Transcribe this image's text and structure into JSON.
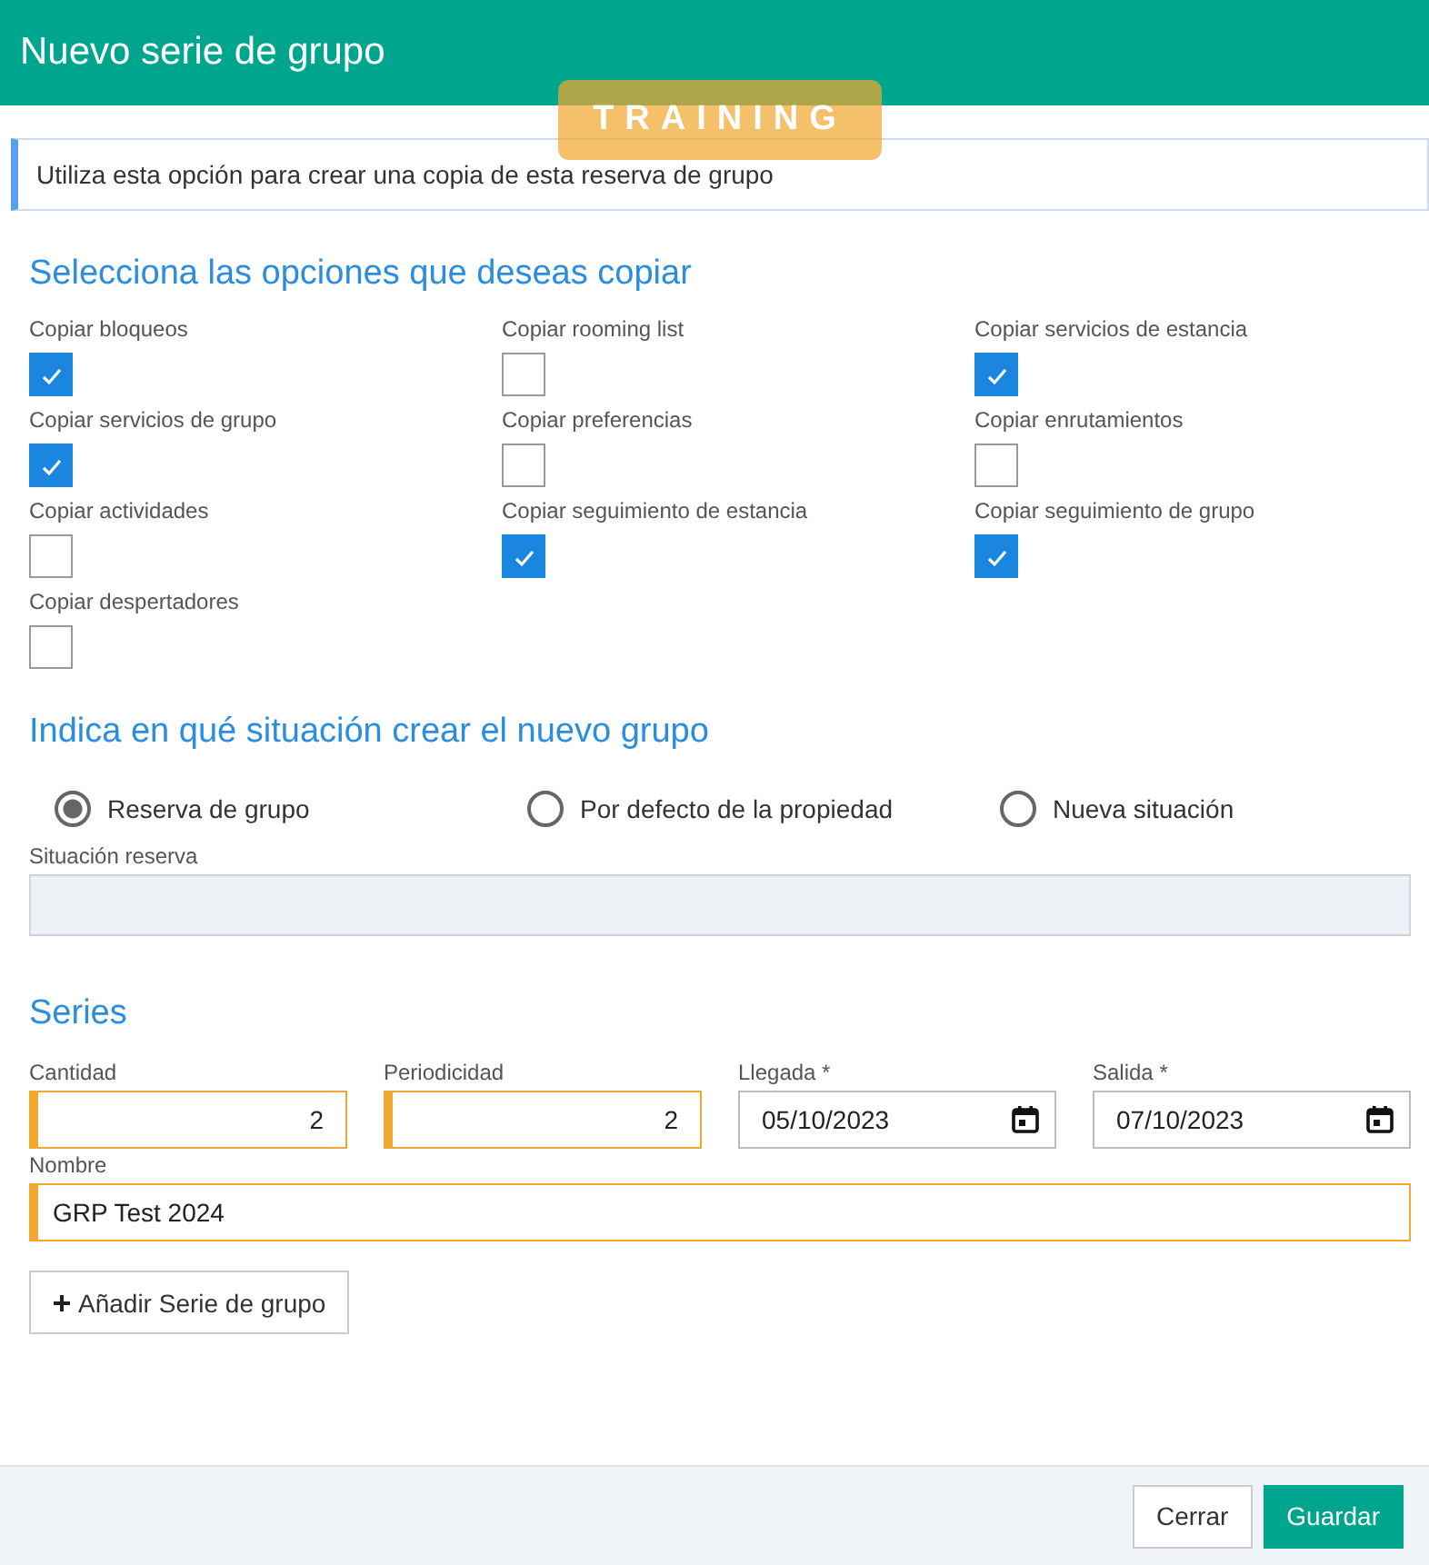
{
  "dialog": {
    "title": "Nuevo serie de grupo"
  },
  "environment_badge": "TRAINING",
  "info": "Utiliza esta opción para crear una copia de esta reserva de grupo",
  "copy_section": {
    "title": "Selecciona las opciones que deseas copiar",
    "options": [
      {
        "label": "Copiar bloqueos",
        "checked": true
      },
      {
        "label": "Copiar rooming list",
        "checked": false
      },
      {
        "label": "Copiar servicios de estancia",
        "checked": true
      },
      {
        "label": "Copiar servicios de grupo",
        "checked": true
      },
      {
        "label": "Copiar preferencias",
        "checked": false
      },
      {
        "label": "Copiar enrutamientos",
        "checked": false
      },
      {
        "label": "Copiar actividades",
        "checked": false
      },
      {
        "label": "Copiar seguimiento de estancia",
        "checked": true
      },
      {
        "label": "Copiar seguimiento de grupo",
        "checked": true
      },
      {
        "label": "Copiar despertadores",
        "checked": false
      }
    ]
  },
  "situation_section": {
    "title": "Indica en qué situación crear el nuevo grupo",
    "choices": [
      {
        "label": "Reserva de grupo",
        "selected": true
      },
      {
        "label": "Por defecto de la propiedad",
        "selected": false
      },
      {
        "label": "Nueva situación",
        "selected": false
      }
    ],
    "field": {
      "label": "Situación reserva",
      "disabled": true
    }
  },
  "series_section": {
    "title": "Series",
    "fields": [
      {
        "label": "Cantidad",
        "value": "2",
        "kind": "number",
        "required": true
      },
      {
        "label": "Periodicidad",
        "value": "2",
        "kind": "number",
        "required": true
      },
      {
        "label": "Llegada *",
        "value": "05/10/2023",
        "kind": "date",
        "required": false
      },
      {
        "label": "Salida *",
        "value": "07/10/2023",
        "kind": "date",
        "required": false
      },
      {
        "label": "Nombre",
        "value": "GRP Test 2024",
        "kind": "text",
        "required": true
      }
    ],
    "add_button": "Añadir Serie de grupo"
  },
  "footer": {
    "buttons": [
      {
        "label": "Cerrar",
        "kind": "secondary"
      },
      {
        "label": "Guardar",
        "kind": "primary"
      }
    ]
  }
}
